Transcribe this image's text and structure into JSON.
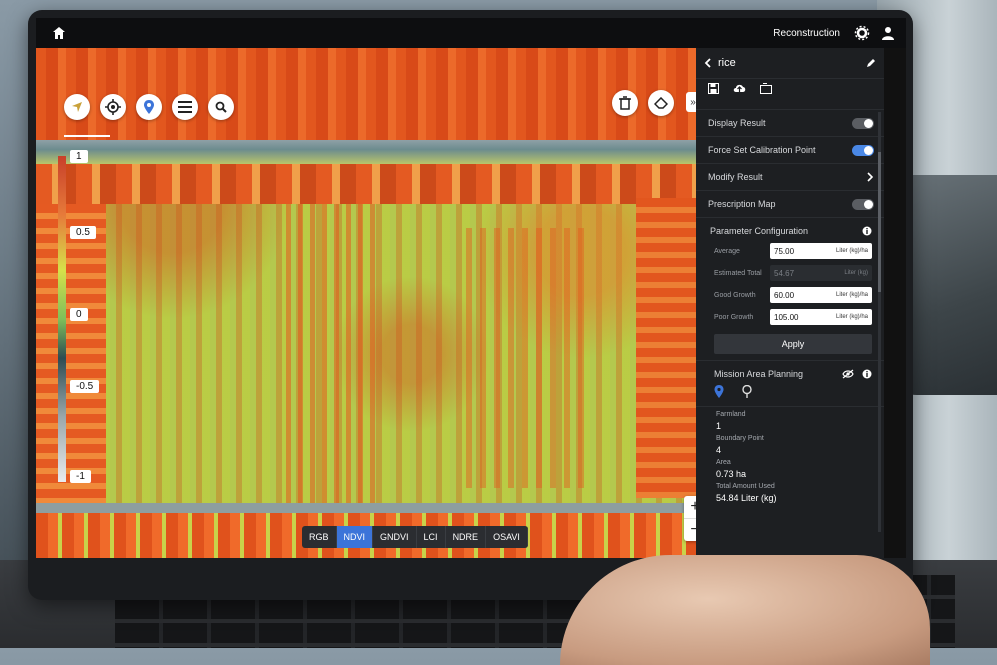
{
  "topbar": {
    "title": "Reconstruction"
  },
  "panel": {
    "header": "rice",
    "rows": {
      "display_result": "Display Result",
      "force_calibration": "Force Set Calibration Point",
      "modify_result": "Modify Result",
      "prescription_map": "Prescription Map"
    },
    "toggles": {
      "display_result": false,
      "force_calibration": true,
      "prescription_map": false
    },
    "parameter_configuration": {
      "title": "Parameter Configuration",
      "fields": [
        {
          "label": "Average",
          "value": "75.00",
          "unit": "Liter (kg)/ha"
        },
        {
          "label": "Estimated Total",
          "value": "54.67",
          "unit": "Liter (kg)"
        },
        {
          "label": "Good Growth",
          "value": "60.00",
          "unit": "Liter (kg)/ha"
        },
        {
          "label": "Poor Growth",
          "value": "105.00",
          "unit": "Liter (kg)/ha"
        }
      ],
      "apply": "Apply"
    },
    "mission": {
      "title": "Mission Area Planning",
      "stats": [
        {
          "label": "Farmland",
          "value": "1"
        },
        {
          "label": "Boundary Point",
          "value": "4"
        },
        {
          "label": "Area",
          "value": "0.73 ha"
        },
        {
          "label": "Total Amount Used",
          "value": "54.84 Liter (kg)"
        }
      ]
    }
  },
  "legend": {
    "ticks": [
      "1",
      "0.5",
      "0",
      "-0.5",
      "-1"
    ]
  },
  "index_bar": {
    "items": [
      "RGB",
      "NDVI",
      "GNDVI",
      "LCI",
      "NDRE",
      "OSAVI"
    ],
    "active": "NDVI"
  },
  "zoom": {
    "in": "+",
    "out": "−"
  },
  "colors": {
    "accent": "#4a88e6",
    "panel_bg": "#1d1f22",
    "index_active": "#3c74d9"
  }
}
